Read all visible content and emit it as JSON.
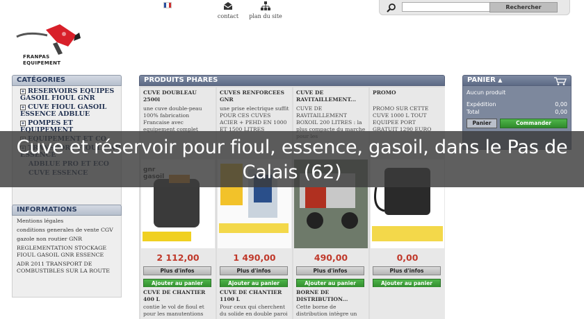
{
  "header": {
    "flag_colors": [
      "#2a4fa0",
      "#ffffff",
      "#d03030"
    ],
    "links": [
      {
        "label": "contact",
        "icon": "envelope-icon"
      },
      {
        "label": "plan du site",
        "icon": "sitemap-icon"
      }
    ],
    "search": {
      "placeholder": "",
      "button_label": "Rechercher"
    },
    "logo": {
      "line1": "FRANPAS",
      "line2": "EQUIPEMENT"
    }
  },
  "categories": {
    "title": "CATÉGORIES",
    "items": [
      {
        "label": "RESERVOIRS EQUIPES GASOIL FIOUL GNR",
        "expandable": true
      },
      {
        "label": "CUVE FIOUL GASOIL ESSENCE ADBLUE",
        "expandable": true
      },
      {
        "label": "POMPES ET EQUIPEMENT",
        "expandable": true
      },
      {
        "label": "EQUIPEMENT ET CO",
        "expandable": true
      },
      {
        "label": "TRANSPORT FIOUL GNR ESSENCE",
        "expandable": true
      },
      {
        "label": "ADBLUE PRO ET ECO",
        "expandable": false
      },
      {
        "label": "CUVE ESSENCE",
        "expandable": false
      }
    ]
  },
  "informations": {
    "title": "INFORMATIONS",
    "items": [
      "Mentions légales",
      "conditions generales de vente CGV",
      "gazole non routier GNR",
      "REGLEMENTATION STOCKAGE FIOUL GASOIL GNR ESSENCE",
      "ADR 2011 TRANSPORT DE COMBUSTIBLES SUR LA ROUTE"
    ]
  },
  "products": {
    "title": "PRODUITS PHARES",
    "info_button": "Plus d'infos",
    "cart_button": "Ajouter au panier",
    "items": [
      {
        "name": "CUVE DOUBLEAU 2500l",
        "desc": "une cuve double-peau 100% fabrication Francaise avec equipement complet",
        "price": "2 112,00",
        "image_label": "gnr gasoil"
      },
      {
        "name": "CUVES RENFORCEES GNR",
        "desc": "une prise electrique suffit POUR CES CUVES ACIER + PEHD EN 1000 ET 1500 LITRES",
        "price": "1 490,00",
        "image_label": ""
      },
      {
        "name": "CUVE DE RAVITAILLEMENT...",
        "desc": "CUVE DE RAVITAILLEMENT BOXOIL 200 LITRES : la plus compacte du marche pour les",
        "price": "490,00",
        "image_label": ""
      },
      {
        "name": "PROMO",
        "desc": "PROMO SUR CETTE CUVE 1000 L TOUT EQUIPEE PORT GRATUIT 1290 EURO",
        "price": "0,00",
        "image_label": ""
      }
    ],
    "row2": [
      {
        "name": "CUVE DE CHANTIER 400 L",
        "desc": "contie le vol de fioul et pour les manutentions"
      },
      {
        "name": "CUVE DE CHANTIER 1100 L",
        "desc": "Pour ceux qui cherchent du solide en double paroi"
      },
      {
        "name": "BORNE DE DISTRIBUTION...",
        "desc": "Cette borne de distribution intègre un"
      },
      {
        "name": "",
        "desc": ""
      }
    ]
  },
  "cart": {
    "title": "PANIER",
    "empty_text": "Aucun produit",
    "shipping_label": "Expédition",
    "shipping_value": "0,00",
    "total_label": "Total",
    "total_value": "0,00",
    "cart_button": "Panier",
    "order_button": "Commander"
  },
  "overlay": {
    "text": "Cuve et réservoir pour fioul, essence, gasoil, dans le Pas de Calais (62)"
  }
}
